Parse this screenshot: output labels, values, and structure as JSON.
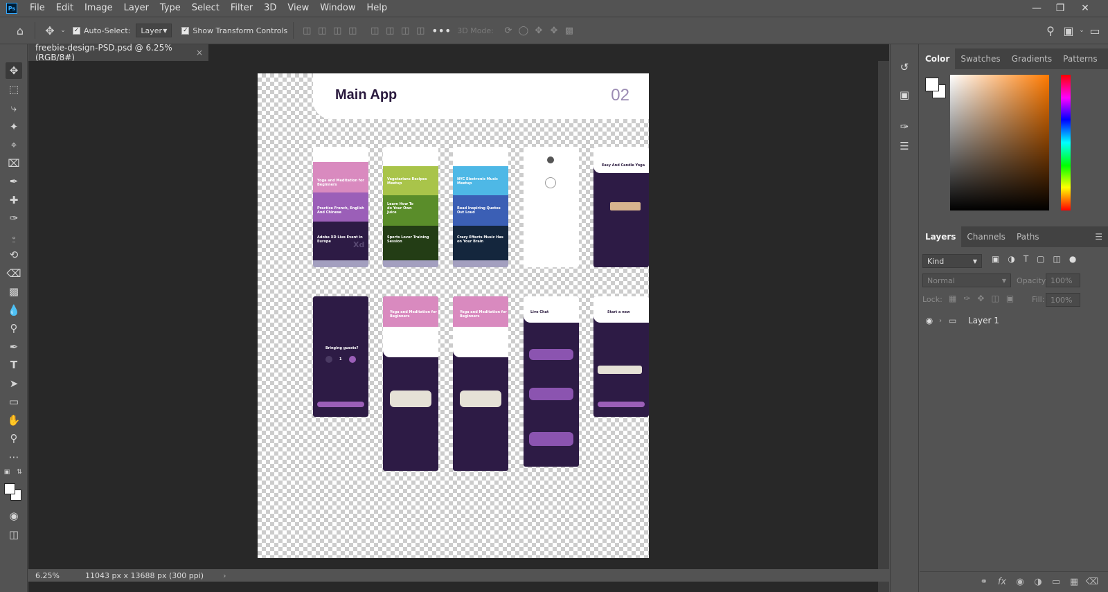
{
  "app": {
    "logo": "Ps"
  },
  "menu": [
    "File",
    "Edit",
    "Image",
    "Layer",
    "Type",
    "Select",
    "Filter",
    "3D",
    "View",
    "Window",
    "Help"
  ],
  "options": {
    "auto_select_label": "Auto-Select:",
    "auto_select_value": "Layer",
    "show_transform_label": "Show Transform Controls",
    "mode_3d_label": "3D Mode:"
  },
  "document": {
    "tab_title": "freebie-design-PSD.psd @ 6.25% (RGB/8#)",
    "zoom": "6.25%",
    "doc_info": "11043 px x 13688 px (300 ppi)"
  },
  "artboard": {
    "title": "Main App",
    "number": "02",
    "phones": {
      "p1": {
        "t1": "Yoga and Meditation for Beginners",
        "t2": "Practice French, English And Chinese",
        "t3": "Adobe XD Live Event in Europe",
        "badge": "Xd"
      },
      "p2": {
        "t1": "Vegetarians Recipes Meetup",
        "t2": "Learn How To do Your Own Juice",
        "t3": "Sports Lover Training Session"
      },
      "p3": {
        "t1": "NYC Electronic Music Meetup",
        "t2": "Read Inspiring Quotes Out Loud",
        "t3": "Crazy Effects Music Has on Your Brain"
      },
      "p5": {
        "t1": "Easy And Candle Yoga"
      },
      "p6": {
        "t1": "Bringing guests?",
        "count": "1"
      },
      "p7": {
        "t1": "Yoga and Meditation for Beginners"
      },
      "p8": {
        "t1": "Yoga and Meditation for Beginners"
      },
      "p9": {
        "t1": "Live Chat"
      },
      "p10": {
        "t1": "Start a new"
      }
    }
  },
  "color_panel": {
    "tabs": [
      "Color",
      "Swatches",
      "Gradients",
      "Patterns"
    ],
    "hue_color": "#ff7a00"
  },
  "layers_panel": {
    "tabs": [
      "Layers",
      "Channels",
      "Paths"
    ],
    "filter": "Kind",
    "blend": "Normal",
    "opacity_label": "Opacity:",
    "opacity": "100%",
    "lock_label": "Lock:",
    "fill_label": "Fill:",
    "fill": "100%",
    "layer_name": "Layer 1"
  },
  "icons": [
    "home-icon",
    "move-icon",
    "search-icon",
    "marquee-icon",
    "lasso-icon",
    "magic-wand-icon",
    "crop-icon",
    "frame-icon",
    "eyedropper-icon",
    "healing-icon",
    "brush-icon",
    "stamp-icon",
    "history-brush-icon",
    "eraser-icon",
    "gradient-icon",
    "blur-icon",
    "dodge-icon",
    "pen-icon",
    "type-icon",
    "path-select-icon",
    "rectangle-icon",
    "hand-icon",
    "zoom-icon",
    "eye-icon",
    "folder-icon"
  ]
}
